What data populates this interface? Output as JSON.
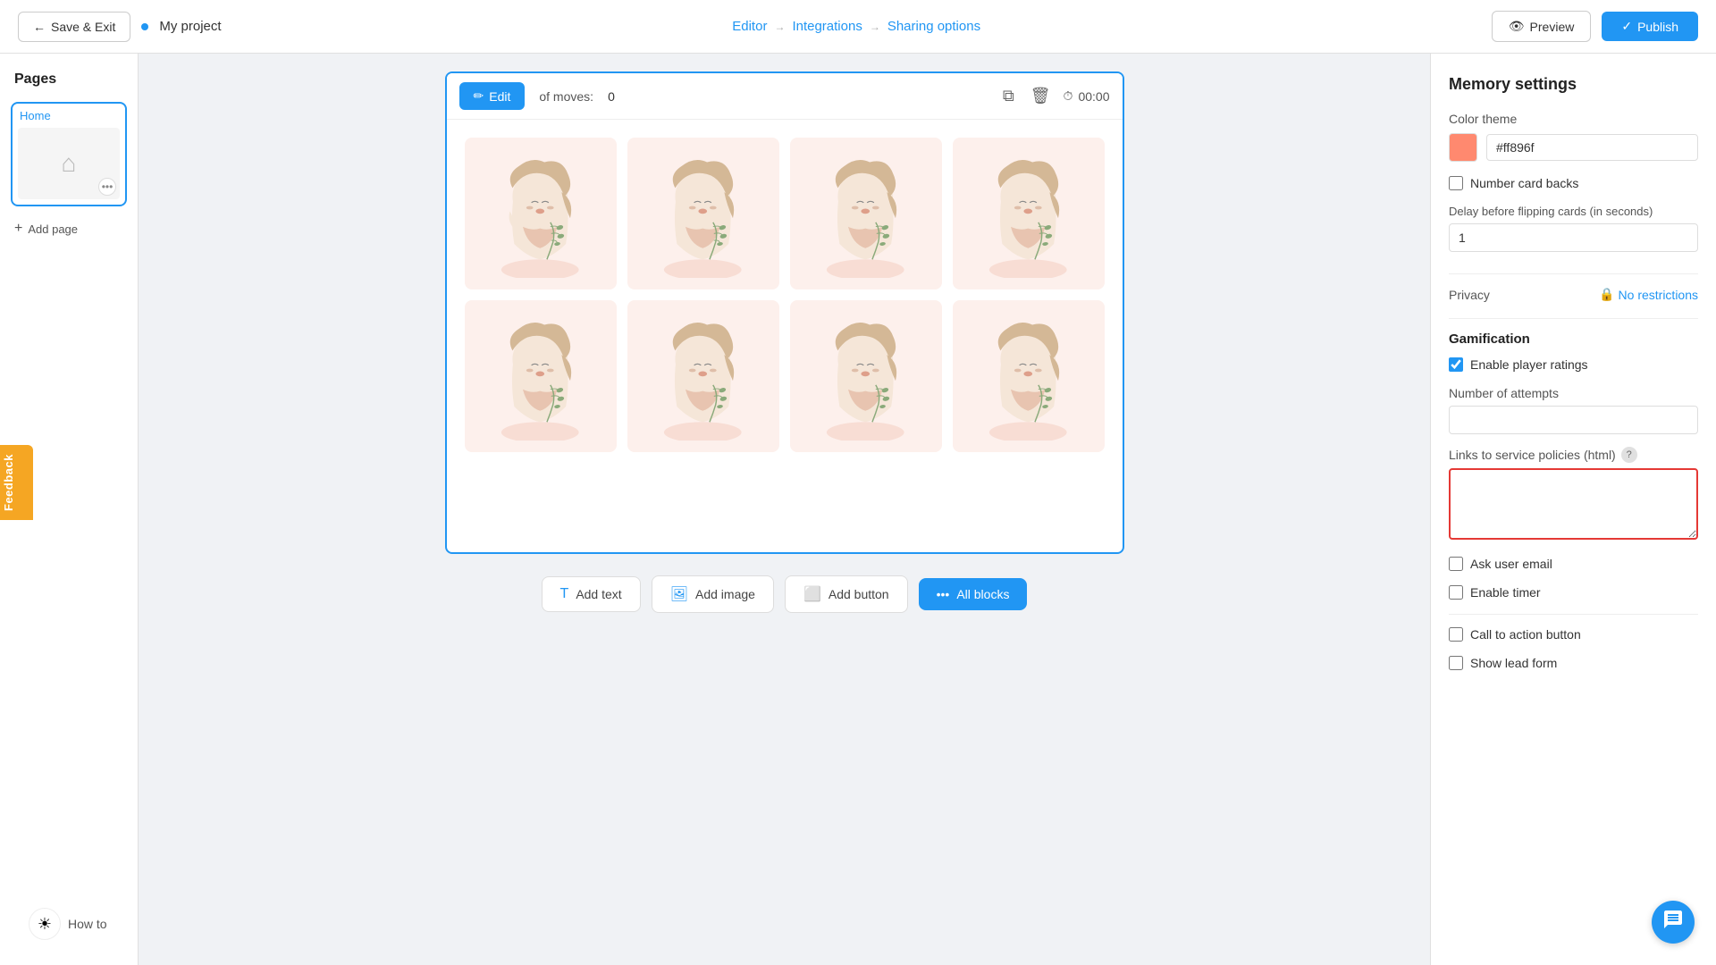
{
  "topbar": {
    "save_exit_label": "Save & Exit",
    "project_name": "My project",
    "nav_editor": "Editor",
    "nav_integrations": "Integrations",
    "nav_sharing": "Sharing options",
    "preview_label": "Preview",
    "publish_label": "Publish"
  },
  "sidebar": {
    "title": "Pages",
    "page_label": "Home",
    "add_page_label": "Add page"
  },
  "canvas": {
    "edit_label": "Edit",
    "moves_label": "of moves:",
    "moves_count": "0",
    "timer_value": "00:00"
  },
  "toolbar": {
    "add_text": "Add text",
    "add_image": "Add image",
    "add_button": "Add button",
    "all_blocks": "All blocks"
  },
  "how_to": {
    "label": "How to"
  },
  "panel": {
    "title": "Memory settings",
    "color_theme_label": "Color theme",
    "color_value": "#ff896f",
    "number_card_backs_label": "Number card backs",
    "delay_label": "Delay before flipping cards (in seconds)",
    "delay_value": "1",
    "privacy_label": "Privacy",
    "no_restrictions_label": "No restrictions",
    "gamification_title": "Gamification",
    "enable_ratings_label": "Enable player ratings",
    "attempts_label": "Number of attempts",
    "policies_label": "Links to service policies (html)",
    "ask_email_label": "Ask user email",
    "enable_timer_label": "Enable timer",
    "cta_label": "Call to action button",
    "lead_form_label": "Show lead form"
  },
  "feedback": {
    "label": "Feedback"
  },
  "icons": {
    "back_arrow": "←",
    "check_arrow": "✓",
    "eye": "👁",
    "edit_pencil": "✏",
    "copy": "⧉",
    "trash": "🗑",
    "clock": "⏱",
    "lock": "🔒",
    "question": "?",
    "sun": "☀",
    "chat": "💬",
    "dots": "•••",
    "home": "⌂",
    "plus": "+"
  }
}
